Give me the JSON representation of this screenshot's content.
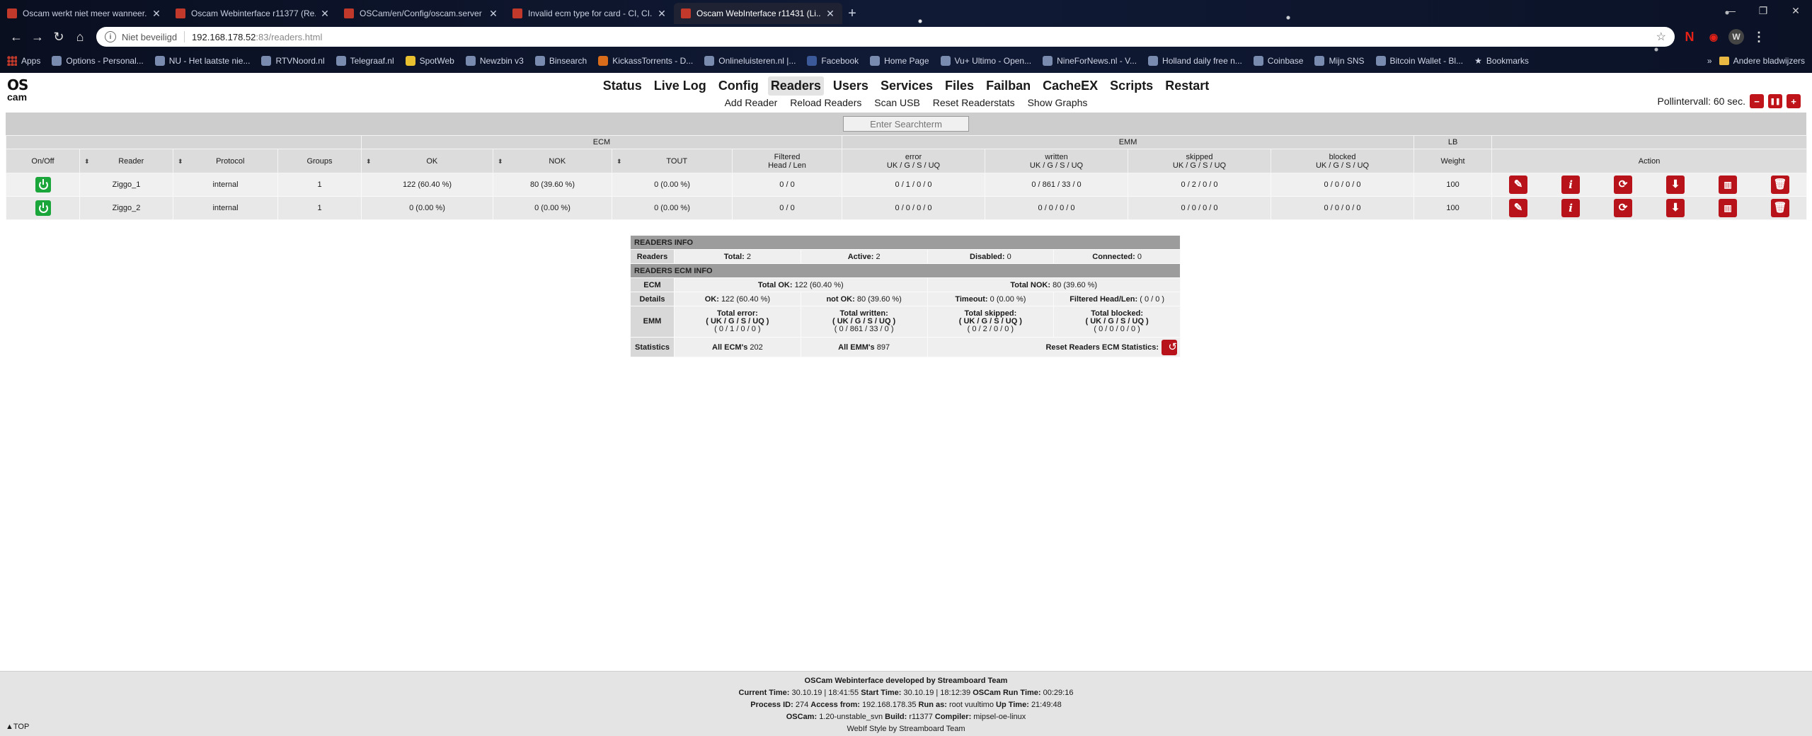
{
  "browser": {
    "tabs": [
      {
        "label": "Oscam werkt niet meer wanneer..."
      },
      {
        "label": "Oscam Webinterface r11377 (Re..."
      },
      {
        "label": "OSCam/en/Config/oscam.server"
      },
      {
        "label": "Invalid ecm type for card - CI, CI..."
      },
      {
        "label": "Oscam WebInterface r11431 (Li..."
      }
    ],
    "url_security": "Niet beveiligd",
    "url_host": "192.168.178.52",
    "url_path": ":83/readers.html",
    "bookmarks": [
      "Apps",
      "Options - Personal...",
      "NU - Het laatste nie...",
      "RTVNoord.nl",
      "Telegraaf.nl",
      "SpotWeb",
      "Newzbin v3",
      "Binsearch",
      "KickassTorrents - D...",
      "Onlineluisteren.nl |...",
      "Facebook",
      "Home Page",
      "Vu+ Ultimo - Open...",
      "NineForNews.nl - V...",
      "Holland daily free n...",
      "Coinbase",
      "Mijn SNS",
      "Bitcoin Wallet - Bl...",
      "Bookmarks"
    ],
    "other_bookmarks": "Andere bladwijzers"
  },
  "logo": {
    "line1": "OS",
    "line2": "cam"
  },
  "menu": [
    "Status",
    "Live Log",
    "Config",
    "Readers",
    "Users",
    "Services",
    "Files",
    "Failban",
    "CacheEX",
    "Scripts",
    "Restart"
  ],
  "submenu": [
    "Add Reader",
    "Reload Readers",
    "Scan USB",
    "Reset Readerstats",
    "Show Graphs"
  ],
  "poll": {
    "label": "Pollintervall: 60 sec.",
    "minus": "−",
    "pause": "❚❚",
    "plus": "+"
  },
  "search_placeholder": "Enter Searchterm",
  "table": {
    "group_ecm": "ECM",
    "group_emm": "EMM",
    "group_lb": "LB",
    "h_onoff": "On/Off",
    "h_reader": "Reader",
    "h_protocol": "Protocol",
    "h_groups": "Groups",
    "h_ok": "OK",
    "h_nok": "NOK",
    "h_tout": "TOUT",
    "h_filtered": "Filtered",
    "h_filtered2": "Head / Len",
    "h_error": "error",
    "h_written": "written",
    "h_skipped": "skipped",
    "h_blocked": "blocked",
    "h_uk": "UK / G / S / UQ",
    "h_weight": "Weight",
    "h_action": "Action",
    "rows": [
      {
        "reader": "Ziggo_1",
        "protocol": "internal",
        "groups": "1",
        "ok": "122 (60.40 %)",
        "nok": "80 (39.60 %)",
        "tout": "0 (0.00 %)",
        "filtered": "0 / 0",
        "error": "0 / 1 / 0 / 0",
        "written": "0 / 861 / 33 / 0",
        "skipped": "0 / 2 / 0 / 0",
        "blocked": "0 / 0 / 0 / 0",
        "weight": "100"
      },
      {
        "reader": "Ziggo_2",
        "protocol": "internal",
        "groups": "1",
        "ok": "0 (0.00 %)",
        "nok": "0 (0.00 %)",
        "tout": "0 (0.00 %)",
        "filtered": "0 / 0",
        "error": "0 / 0 / 0 / 0",
        "written": "0 / 0 / 0 / 0",
        "skipped": "0 / 0 / 0 / 0",
        "blocked": "0 / 0 / 0 / 0",
        "weight": "100"
      }
    ],
    "action_icons": [
      "edit-icon",
      "info-icon",
      "refresh-icon",
      "download-icon",
      "stats-icon",
      "delete-icon"
    ]
  },
  "info": {
    "readers_info": "READERS INFO",
    "readers": "Readers",
    "total_label": "Total:",
    "total": "2",
    "active_label": "Active:",
    "active": "2",
    "disabled_label": "Disabled:",
    "disabled": "0",
    "connected_label": "Connected:",
    "connected": "0",
    "ecm_info": "READERS ECM INFO",
    "ecm": "ECM",
    "total_ok_label": "Total OK:",
    "total_ok": "122 (60.40 %)",
    "total_nok_label": "Total NOK:",
    "total_nok": "80 (39.60 %)",
    "details": "Details",
    "d_ok_label": "OK:",
    "d_ok": "122 (60.40 %)",
    "d_notok_label": "not OK:",
    "d_notok": "80 (39.60 %)",
    "d_timeout_label": "Timeout:",
    "d_timeout": "0 (0.00 %)",
    "d_filtered_label": "Filtered Head/Len:",
    "d_filtered": "( 0 / 0 )",
    "emm": "EMM",
    "e_error_label": "Total error:",
    "e_error": "( 0 / 1 / 0 / 0 )",
    "e_written_label": "Total written:",
    "e_written": "( 0 / 861 / 33 / 0 )",
    "e_skipped_label": "Total skipped:",
    "e_skipped": "( 0 / 2 / 0 / 0 )",
    "e_blocked_label": "Total blocked:",
    "e_blocked": "( 0 / 0 / 0 / 0 )",
    "e_sub": "( UK / G / S / UQ )",
    "statistics": "Statistics",
    "all_ecms_label": "All ECM's",
    "all_ecms": "202",
    "all_emms_label": "All EMM's",
    "all_emms": "897",
    "reset_label": "Reset Readers ECM Statistics:"
  },
  "footer": {
    "line1": "OSCam Webinterface developed by Streamboard Team",
    "current_time_label": "Current Time:",
    "current_time": "30.10.19 | 18:41:55",
    "start_time_label": "Start Time:",
    "start_time": "30.10.19 | 18:12:39",
    "run_time_label": "OSCam Run Time:",
    "run_time": "00:29:16",
    "pid_label": "Process ID:",
    "pid": "274",
    "access_label": "Access from:",
    "access": "192.168.178.35",
    "runas_label": "Run as:",
    "runas": "root",
    "host": "vuultimo",
    "uptime_label": "Up Time:",
    "uptime": "21:49:48",
    "oscam_label": "OSCam:",
    "oscam": "1.20-unstable_svn",
    "build_label": "Build:",
    "build": "r11377",
    "compiler_label": "Compiler:",
    "compiler": "mipsel-oe-linux",
    "style": "WebIf Style by Streamboard Team",
    "top": "▲TOP"
  }
}
